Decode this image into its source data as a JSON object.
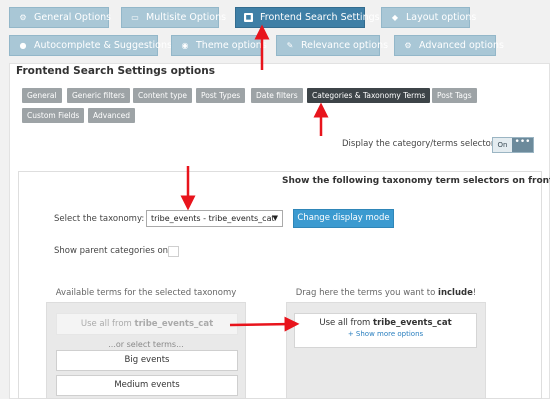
{
  "tabs_row1": [
    {
      "label": "General Options",
      "icon": "gear-icon",
      "glyph": "⚙"
    },
    {
      "label": "Multisite Options",
      "icon": "document-icon",
      "glyph": "▭"
    },
    {
      "label": "Frontend Search Settings",
      "icon": "window-icon",
      "glyph": "■",
      "active": true
    },
    {
      "label": "Layout options",
      "icon": "diamond-icon",
      "glyph": "◆"
    }
  ],
  "tabs_row2": [
    {
      "label": "Autocomplete & Suggestions",
      "icon": "bulb-icon",
      "glyph": "●"
    },
    {
      "label": "Theme options",
      "icon": "eye-icon",
      "glyph": "◉"
    },
    {
      "label": "Relevance options",
      "icon": "wrench-icon",
      "glyph": "✎"
    },
    {
      "label": "Advanced options",
      "icon": "settings-icon",
      "glyph": "⚙"
    }
  ],
  "section_title": "Frontend Search Settings options",
  "subtabs": [
    "General",
    "Generic filters",
    "Content type",
    "Post Types",
    "Date filters",
    "Categories & Taxonomy Terms",
    "Post Tags",
    "Custom Fields",
    "Advanced"
  ],
  "active_subtab": "Categories & Taxonomy Terms",
  "display_selectors_label": "Display the category/terms selectors?",
  "toggle": {
    "on_label": "On",
    "knob": "•••",
    "state": "on"
  },
  "inner_title": "Show the following taxonomy term selectors on frontend",
  "taxonomy_label": "Select the taxonomy:",
  "taxonomy_value": "tribe_events - tribe_events_cat",
  "change_mode_label": "Change display mode",
  "parent_only_label": "Show parent categories only",
  "available_heading": "Available terms for the selected taxonomy",
  "drag_heading_prefix": "Drag here the terms you want to ",
  "drag_heading_bold": "include",
  "drag_heading_suffix": "!",
  "use_all_prefix": "Use all from ",
  "use_all_tax": "tribe_events_cat",
  "or_select": "...or select terms...",
  "terms": [
    "Big events",
    "Medium events"
  ],
  "show_more": "+ Show more options",
  "colors": {
    "tab": "#a9c7d6",
    "tab_active": "#3f7fa6",
    "button": "#3b9ad0",
    "arrow": "#e8141c"
  }
}
